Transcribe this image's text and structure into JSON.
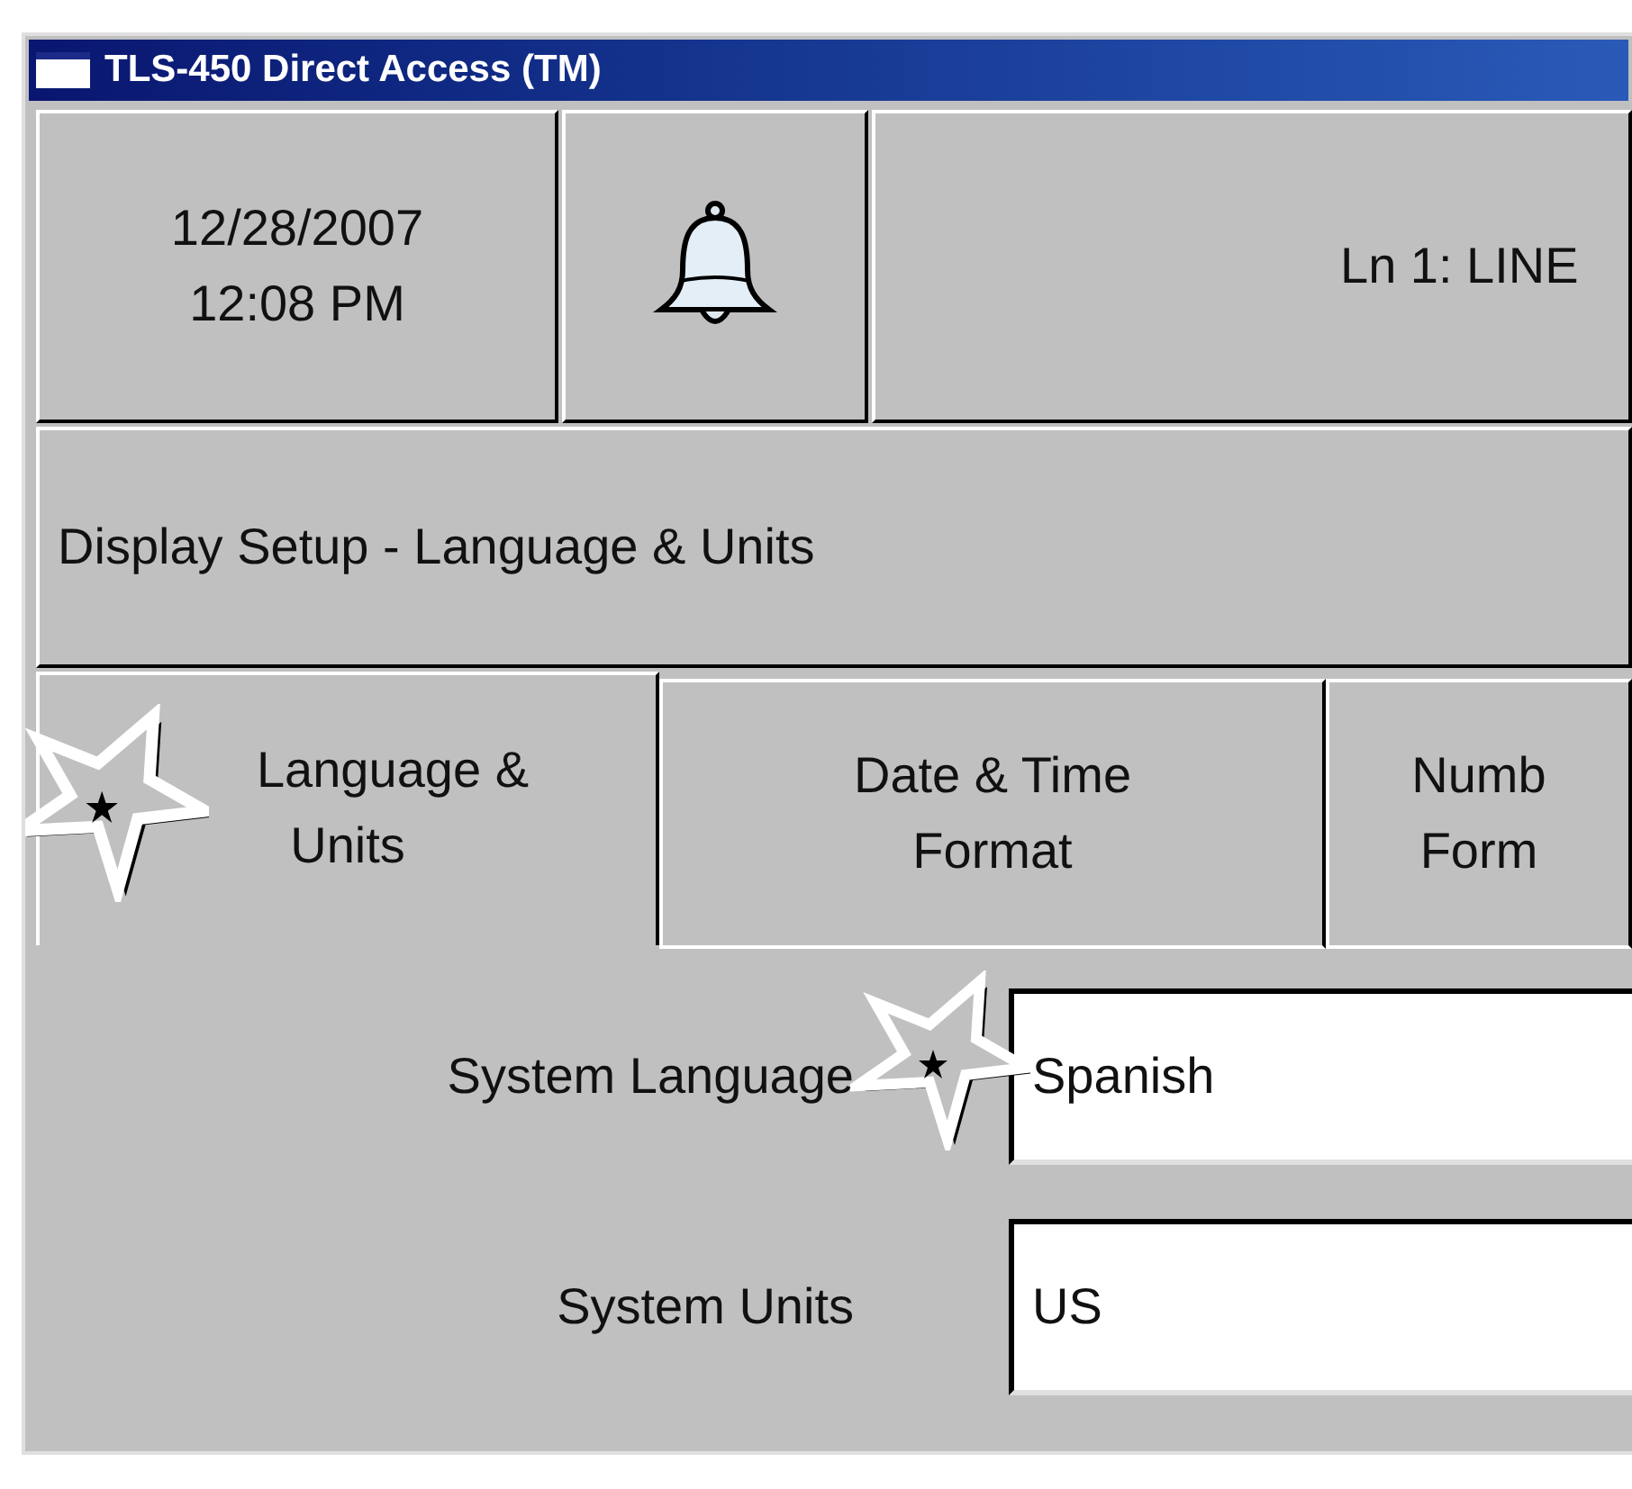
{
  "window": {
    "title": "TLS-450 Direct Access (TM)"
  },
  "header": {
    "date": "12/28/2007",
    "time": "12:08 PM",
    "status": "Ln 1: LINE"
  },
  "subtitle": "Display Setup - Language & Units",
  "tabs": [
    {
      "lines": [
        "Language &",
        "Units"
      ],
      "selected": true,
      "marked": true
    },
    {
      "lines": [
        "Date & Time",
        "Format"
      ],
      "selected": false,
      "marked": false
    },
    {
      "lines": [
        "Numb",
        "Form"
      ],
      "selected": false,
      "marked": false
    }
  ],
  "fields": [
    {
      "label": "System Language",
      "value": "Spanish",
      "marked": true
    },
    {
      "label": "System Units",
      "value": "US",
      "marked": false
    }
  ]
}
